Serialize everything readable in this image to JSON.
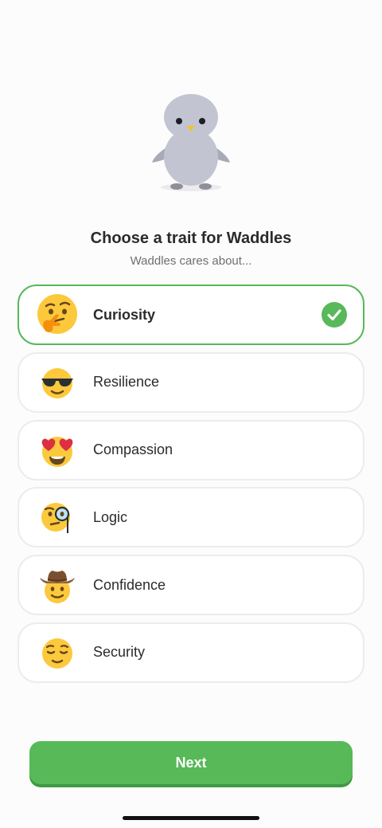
{
  "header": {
    "title": "Choose a trait for Waddles",
    "subtitle": "Waddles cares about..."
  },
  "mascot": {
    "icon": "penguin-mascot-icon",
    "body_color": "#c3c4d1",
    "beak_color": "#f2c12e"
  },
  "traits": [
    {
      "label": "Curiosity",
      "icon": "thinking-face-icon",
      "selected": true
    },
    {
      "label": "Resilience",
      "icon": "sunglasses-face-icon",
      "selected": false
    },
    {
      "label": "Compassion",
      "icon": "heart-eyes-face-icon",
      "selected": false
    },
    {
      "label": "Logic",
      "icon": "monocle-face-icon",
      "selected": false
    },
    {
      "label": "Confidence",
      "icon": "cowboy-face-icon",
      "selected": false
    },
    {
      "label": "Security",
      "icon": "relieved-face-icon",
      "selected": false
    }
  ],
  "colors": {
    "accent": "#58b85a",
    "button": "#57b957",
    "emoji_yellow": "#fcc93d"
  },
  "footer": {
    "next_label": "Next"
  }
}
